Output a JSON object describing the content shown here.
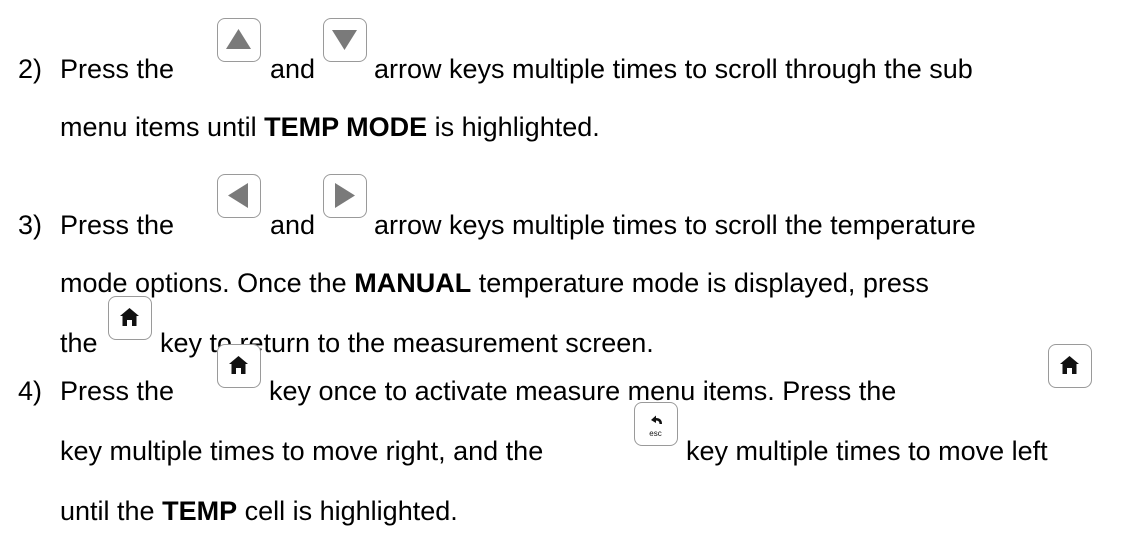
{
  "steps": [
    {
      "number": "2)",
      "line1_a": "Press the",
      "line1_b": "and",
      "line1_c": "arrow keys multiple times to scroll through the sub",
      "line2_a": "menu items until",
      "line2_bold": "TEMP MODE",
      "line2_b": "is highlighted.",
      "keys": [
        "up-arrow-key",
        "down-arrow-key"
      ]
    },
    {
      "number": "3)",
      "line1_a": "Press the",
      "line1_b": "and",
      "line1_c": "arrow keys multiple times to scroll the temperature",
      "line2_a": "mode options.  Once the",
      "line2_bold": "MANUAL",
      "line2_b": "temperature mode is displayed, press",
      "line3_a": "the",
      "line3_b": "key to return to the measurement screen.",
      "keys": [
        "left-arrow-key",
        "right-arrow-key",
        "home-key"
      ]
    },
    {
      "number": "4)",
      "line1_a": "Press the",
      "line1_b": "key once to activate measure menu items.  Press the",
      "line2_a": "key multiple times to move right, and the",
      "line2_b": "key multiple times to move left",
      "line3_a": "until the",
      "line3_bold": "TEMP",
      "line3_b": "cell is highlighted.",
      "keys": [
        "home-key",
        "home-key",
        "esc-key"
      ],
      "esc_label": "esc"
    }
  ]
}
